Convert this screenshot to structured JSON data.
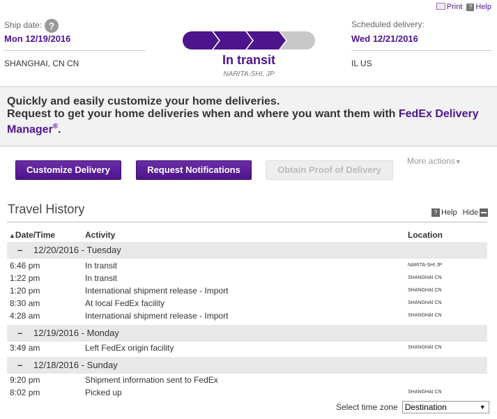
{
  "top_links": {
    "print": "Print",
    "help": "Help"
  },
  "shipment": {
    "ship_date_label": "Ship date:",
    "ship_date": "Mon 12/19/2016",
    "origin": "SHANGHAI, CN CN",
    "sched_label": "Scheduled delivery:",
    "sched_date": "Wed 12/21/2016",
    "destination": "IL US",
    "status": "In transit",
    "status_location": "NARITA-SHI, JP",
    "progress_steps_completed": 3,
    "progress_steps_total": 4
  },
  "banner": {
    "line1": "Quickly and easily customize your home deliveries.",
    "line2_prefix": "Request to get your home deliveries when and where you want them with ",
    "link_text_1": "FedEx Delivery",
    "link_text_2": "Manager",
    "reg": "®",
    "suffix": "."
  },
  "actions": {
    "customize": "Customize Delivery",
    "notify": "Request Notifications",
    "proof": "Obtain Proof of Delivery",
    "more": "More actions"
  },
  "travel_history": {
    "title": "Travel History",
    "help": "Help",
    "hide": "Hide",
    "col_date": "Date/Time",
    "col_activity": "Activity",
    "col_location": "Location",
    "groups": [
      {
        "date": "12/20/2016 - Tuesday",
        "events": [
          {
            "time": "6:46 pm",
            "activity": "In transit",
            "location": "NARITA-SHI JP"
          },
          {
            "time": "1:22 pm",
            "activity": "In transit",
            "location": "SHANGHAI CN"
          },
          {
            "time": "1:20 pm",
            "activity": "International shipment release - Import",
            "location": "SHANGHAI CN"
          },
          {
            "time": "8:30 am",
            "activity": "At local FedEx facility",
            "location": "SHANGHAI CN"
          },
          {
            "time": "4:28 am",
            "activity": "International shipment release - Import",
            "location": "SHANGHAI CN"
          }
        ]
      },
      {
        "date": "12/19/2016 - Monday",
        "events": [
          {
            "time": "3:49 am",
            "activity": "Left FedEx origin facility",
            "location": "SHANGHAI CN"
          }
        ]
      },
      {
        "date": "12/18/2016 - Sunday",
        "events": [
          {
            "time": "9:20 pm",
            "activity": "Shipment information sent to FedEx",
            "location": ""
          },
          {
            "time": "8:02 pm",
            "activity": "Picked up",
            "location": "SHANGHAI CN"
          }
        ]
      }
    ],
    "timezone_label": "Select time zone",
    "timezone_value": "Destination"
  }
}
